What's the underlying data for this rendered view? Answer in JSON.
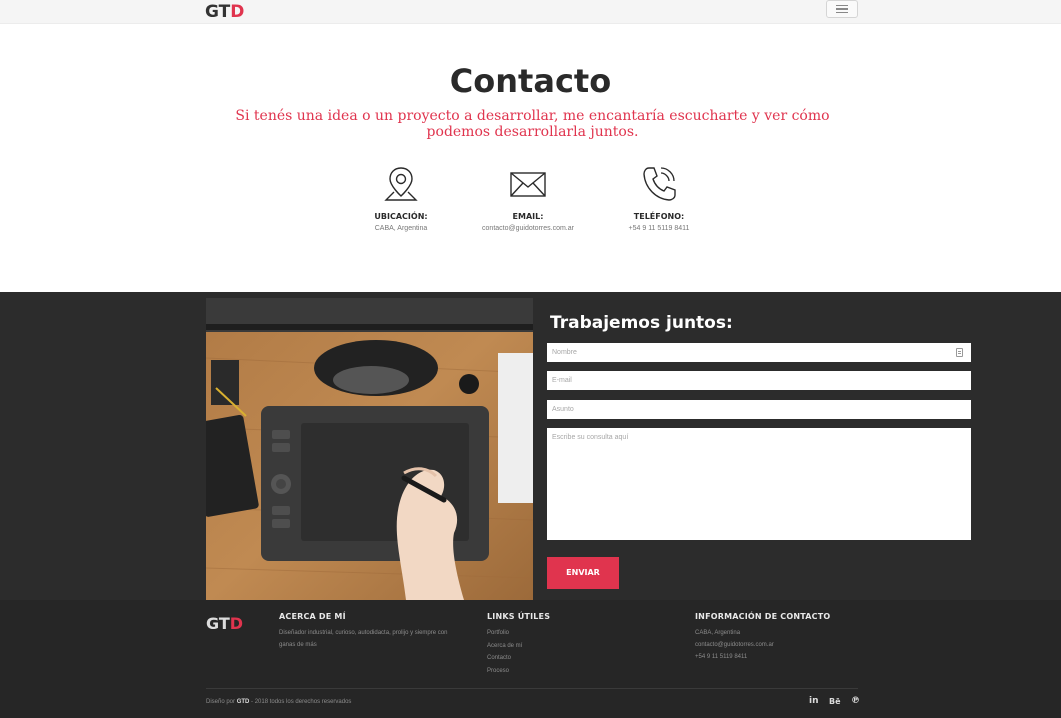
{
  "nav": {
    "logo_main": "GT",
    "logo_accent": "D"
  },
  "contact": {
    "title": "Contacto",
    "subtitle": "Si tenés una idea o un proyecto a desarrollar, me encantaría escucharte y ver cómo podemos desarrollarla juntos.",
    "items": [
      {
        "icon": "location-pin-icon",
        "label": "UBICACIÓN:",
        "value": "CABA, Argentina"
      },
      {
        "icon": "envelope-icon",
        "label": "EMAIL:",
        "value": "contacto@guidotorres.com.ar"
      },
      {
        "icon": "phone-icon",
        "label": "TELÉFONO:",
        "value": "+54 9 11 5119 8411"
      }
    ]
  },
  "form": {
    "title": "Trabajemos juntos:",
    "name_placeholder": "Nombre",
    "email_placeholder": "E-mail",
    "subject_placeholder": "Asunto",
    "message_placeholder": "Escribe su consulta aquí",
    "submit_label": "ENVIAR"
  },
  "footer": {
    "logo_main": "GT",
    "logo_accent": "D",
    "about": {
      "heading": "ACERCA DE MÍ",
      "text": "Diseñador industrial, curioso, autodidacta, prolijo y siempre con ganas de más"
    },
    "links": {
      "heading": "LINKS ÚTILES",
      "items": [
        "Portfolio",
        "Acerca de mí",
        "Contacto",
        "Proceso"
      ]
    },
    "contact_info": {
      "heading": "INFORMACIÓN DE CONTACTO",
      "location": "CABA, Argentina",
      "email": "contacto@guidotorres.com.ar",
      "phone": "+54 9 11 5119 8411"
    },
    "copyright_prefix": "Diseño por",
    "copyright_brand": "GTD",
    "copyright_suffix": "- 2018 todos los derechos reservados",
    "social": [
      "in",
      "Bē",
      "℗"
    ]
  },
  "colors": {
    "accent": "#e0344e",
    "dark_band": "#2c2c2c",
    "footer": "#262626"
  }
}
